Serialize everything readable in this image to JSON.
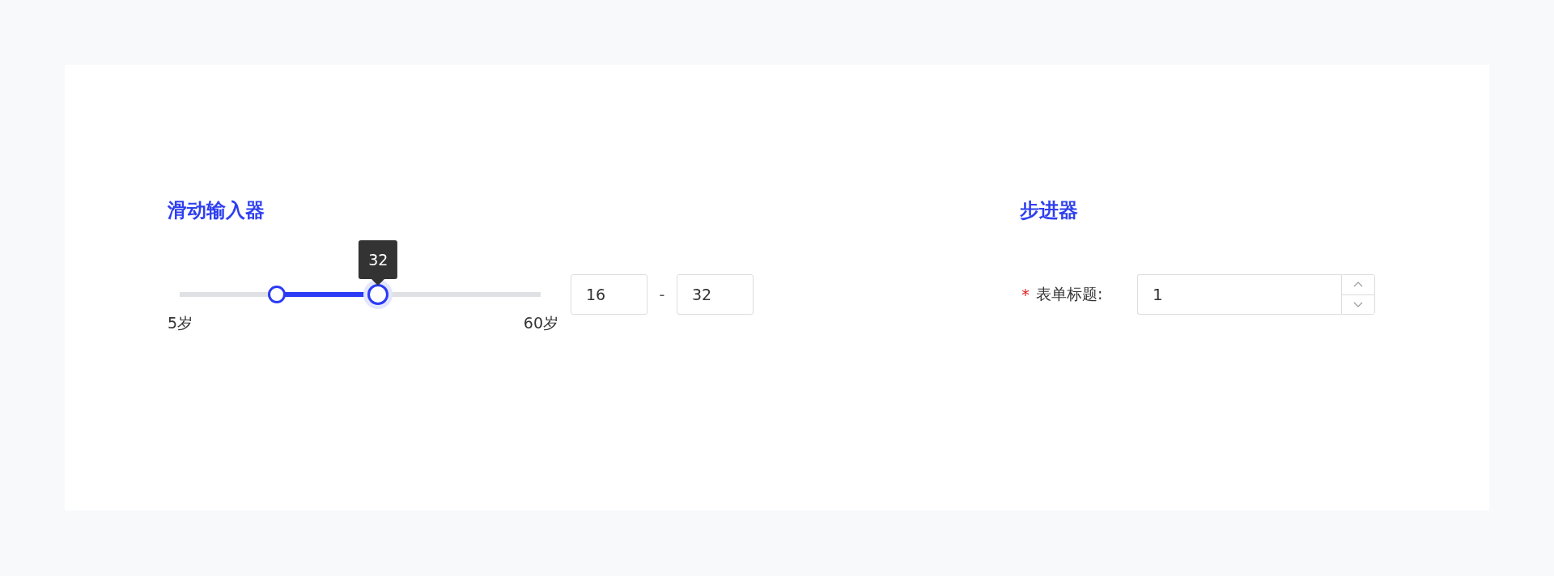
{
  "slider_section": {
    "title": "滑动输入器",
    "slider": {
      "handles": [
        {
          "level": 0.27,
          "active": false
        },
        {
          "level": 0.55,
          "active": true
        }
      ],
      "tooltip": "32",
      "min_label": "5岁",
      "max_label": "60岁"
    },
    "range_inputs": [
      {
        "value": "16"
      },
      {
        "value": "32"
      }
    ],
    "separator": "-"
  },
  "stepper_section": {
    "title": "步进器",
    "field": {
      "required_mark": "*",
      "label": "表单标题:",
      "value": "1"
    }
  }
}
